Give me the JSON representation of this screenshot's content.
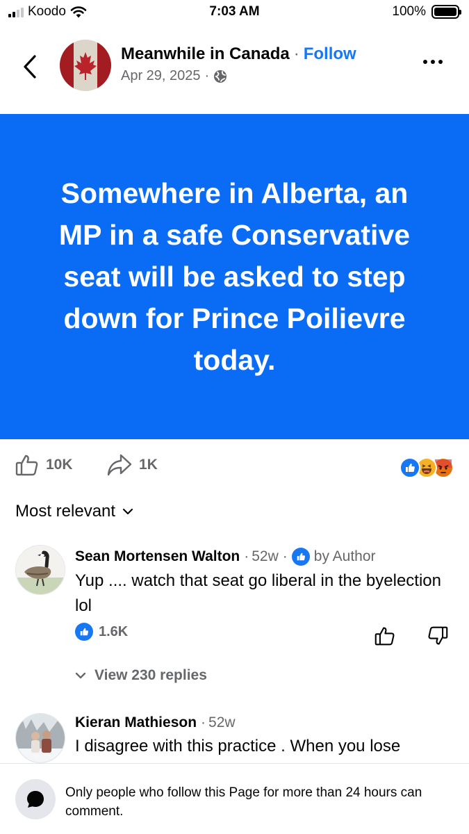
{
  "status_bar": {
    "carrier": "Koodo",
    "time": "7:03 AM",
    "battery": "100%"
  },
  "header": {
    "page_name": "Meanwhile in Canada",
    "separator": "·",
    "follow_label": "Follow",
    "date": "Apr 29, 2025",
    "date_separator": "·",
    "icons": [
      "back-icon",
      "globe-icon",
      "more-icon"
    ]
  },
  "post": {
    "text": "Somewhere in Alberta, an MP in a safe Conservative seat will be asked to step down for Prince Poilievre today.",
    "background_color": "#0a6cf5"
  },
  "actions": {
    "like_count": "10K",
    "share_count": "1K",
    "reactions": [
      "like",
      "haha",
      "angry"
    ]
  },
  "sort": {
    "label": "Most relevant"
  },
  "comments": [
    {
      "name": "Sean Mortensen Walton",
      "age": "52w",
      "badge": "by Author",
      "text": "Yup .... watch that seat go liberal in the byelection lol",
      "likes": "1.6K",
      "replies_label": "View 230 replies"
    },
    {
      "name": "Kieran Mathieson",
      "age": "52w",
      "text": "I disagree with this practice . When you lose"
    }
  ],
  "footer": {
    "text": "Only people who follow this Page for more than 24 hours can comment."
  },
  "colors": {
    "accent": "#1877f2",
    "secondary_text": "#65676b"
  }
}
